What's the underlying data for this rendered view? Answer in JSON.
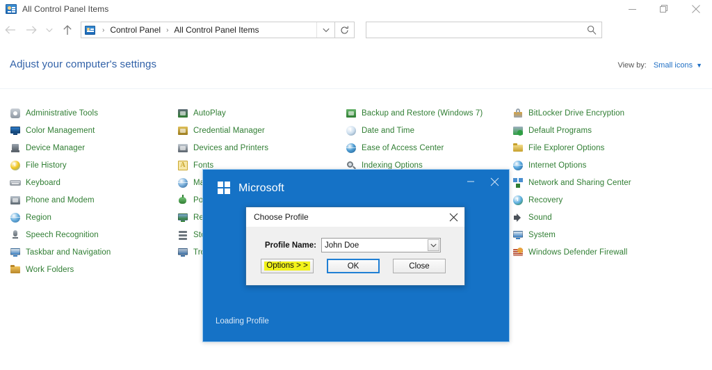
{
  "window": {
    "title": "All Control Panel Items",
    "title_icon": "control-panel-icon",
    "minimize_label": "Minimize",
    "restore_label": "Restore",
    "close_label": "Close"
  },
  "nav": {
    "back_label": "Back",
    "forward_label": "Forward",
    "recent_label": "Recent locations",
    "up_label": "Up",
    "breadcrumbs": [
      "Control Panel",
      "All Control Panel Items"
    ],
    "separator": "›",
    "dropdown_label": "Previous locations",
    "refresh_label": "Refresh"
  },
  "search": {
    "value": "",
    "placeholder": "",
    "icon": "search-icon"
  },
  "header": {
    "page_title": "Adjust your computer's settings",
    "view_by_label": "View by:",
    "view_by_value": "Small icons",
    "view_by_caret": "▼"
  },
  "items": {
    "col1": [
      {
        "label": "Administrative Tools",
        "icon": "administrative-tools-icon"
      },
      {
        "label": "Color Management",
        "icon": "color-management-icon"
      },
      {
        "label": "Device Manager",
        "icon": "device-manager-icon"
      },
      {
        "label": "File History",
        "icon": "file-history-icon"
      },
      {
        "label": "Keyboard",
        "icon": "keyboard-icon"
      },
      {
        "label": "Phone and Modem",
        "icon": "phone-and-modem-icon"
      },
      {
        "label": "Region",
        "icon": "region-icon"
      },
      {
        "label": "Speech Recognition",
        "icon": "speech-recognition-icon"
      },
      {
        "label": "Taskbar and Navigation",
        "icon": "taskbar-and-navigation-icon"
      },
      {
        "label": "Work Folders",
        "icon": "work-folders-icon"
      }
    ],
    "col2": [
      {
        "label": "AutoPlay",
        "icon": "autoplay-icon"
      },
      {
        "label": "Credential Manager",
        "icon": "credential-manager-icon"
      },
      {
        "label": "Devices and Printers",
        "icon": "devices-and-printers-icon"
      },
      {
        "label": "Fonts",
        "icon": "fonts-icon"
      },
      {
        "label": "Ma",
        "icon": "mail-icon"
      },
      {
        "label": "Po",
        "icon": "power-options-icon"
      },
      {
        "label": "Re",
        "icon": "remoteapp-icon"
      },
      {
        "label": "Sto",
        "icon": "storage-spaces-icon"
      },
      {
        "label": "Tro",
        "icon": "troubleshooting-icon"
      }
    ],
    "col3": [
      {
        "label": "Backup and Restore (Windows 7)",
        "icon": "backup-and-restore-icon"
      },
      {
        "label": "Date and Time",
        "icon": "date-and-time-icon"
      },
      {
        "label": "Ease of Access Center",
        "icon": "ease-of-access-icon"
      },
      {
        "label": "Indexing Options",
        "icon": "indexing-options-icon"
      }
    ],
    "col4": [
      {
        "label": "BitLocker Drive Encryption",
        "icon": "bitlocker-icon"
      },
      {
        "label": "Default Programs",
        "icon": "default-programs-icon"
      },
      {
        "label": "File Explorer Options",
        "icon": "file-explorer-options-icon"
      },
      {
        "label": "Internet Options",
        "icon": "internet-options-icon"
      },
      {
        "label": "Network and Sharing Center",
        "icon": "network-sharing-icon"
      },
      {
        "label": "Recovery",
        "icon": "recovery-icon"
      },
      {
        "label": "Sound",
        "icon": "sound-icon"
      },
      {
        "label": "System",
        "icon": "system-icon"
      },
      {
        "label": "Windows Defender Firewall",
        "icon": "firewall-icon"
      }
    ]
  },
  "ms_window": {
    "brand": "Microsoft",
    "logo_icon": "microsoft-logo-icon",
    "minimize_label": "–",
    "close_label": "✕",
    "status": "Loading Profile"
  },
  "profile_dialog": {
    "title": "Choose Profile",
    "close_label": "✕",
    "field_label": "Profile Name:",
    "field_value": "John Doe",
    "dropdown_icon": "chevron-down-icon",
    "buttons": {
      "options": "Options > >",
      "ok": "OK",
      "close": "Close"
    }
  },
  "colors": {
    "ms_blue": "#1572c6",
    "link_blue": "#1f6fc4",
    "item_green": "#2f7d32",
    "highlight_yellow": "#f2f21a",
    "focus_blue": "#1f7fd4"
  }
}
